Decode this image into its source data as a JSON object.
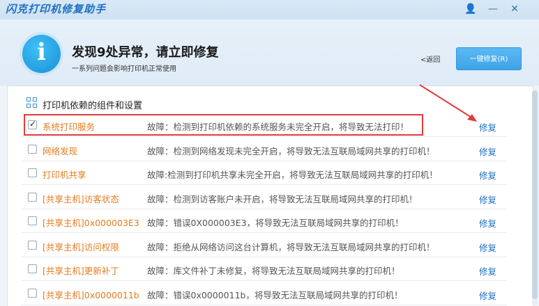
{
  "window": {
    "app_title": "闪克打印机修复助手",
    "controls": {
      "user": "👤",
      "minimize": "—",
      "close": "✕"
    }
  },
  "header": {
    "title": "发现9处异常，请立即修复",
    "subtitle": "一系列问题会影响打印机正常使用",
    "back_label": "<返回",
    "fix_all_label": "一键修复(R)"
  },
  "section": {
    "title": "打印机依赖的组件和设置"
  },
  "colors": {
    "accent": "#1b6fc7",
    "warning_text": "#e57b1d",
    "highlight": "#e23a3a"
  },
  "items": [
    {
      "name": "系统打印服务",
      "desc": "故障：检测到打印机依赖的系统服务未完全开启，将导致无法打印！",
      "fix": "修复",
      "checked": true
    },
    {
      "name": "网络发现",
      "desc": "故障：检测到网络发现未完全开启，将导致无法互联局域网共享的打印机！",
      "fix": "修复",
      "checked": false
    },
    {
      "name": "打印机共享",
      "desc": "故障:检测到打印机共享未完全开启，将导致无法互联局域网共享的打印机！",
      "fix": "修复",
      "checked": false
    },
    {
      "name": "[共享主机]访客状态",
      "desc": "故障：检测到访客账户未开启，将导致无法互联局域网共享的打印机！",
      "fix": "修复",
      "checked": false
    },
    {
      "name": "[共享主机]0x000003E3",
      "desc": "故障：错误0X000003E3，将导致无法互联局域网共享的打印机！",
      "fix": "修复",
      "checked": false
    },
    {
      "name": "[共享主机]访问权限",
      "desc": "故障：拒绝从网络访问这台计算机，将导致无法互联局域网共享的打印机！",
      "fix": "修复",
      "checked": false
    },
    {
      "name": "[共享主机]更新补丁",
      "desc": "故障：库文件补丁未修复，将导致无法互联局域网共享的打印机！",
      "fix": "修复",
      "checked": false
    },
    {
      "name": "[共享主机]0x0000011b",
      "desc": "故障：错误0x0000011b，将导致无法互联局域网共享的打印机！",
      "fix": "修复",
      "checked": false
    }
  ]
}
